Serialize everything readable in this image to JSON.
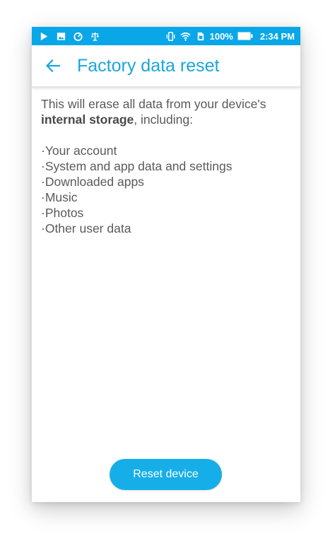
{
  "status_bar": {
    "left_icons": [
      "play-store-icon",
      "image-icon",
      "speedometer-icon",
      "scale-icon"
    ],
    "right_icons": [
      "vibrate-icon",
      "wifi-icon",
      "sim-icon"
    ],
    "battery_percent": "100%",
    "time": "2:34 PM"
  },
  "header": {
    "title": "Factory data reset",
    "back_icon": "arrow-left-icon"
  },
  "content": {
    "intro_prefix": "This will erase all data from your device's",
    "intro_bold": "internal storage",
    "intro_suffix": ", including:",
    "items": [
      "Your account",
      "System and app data and settings",
      "Downloaded apps",
      "Music",
      "Photos",
      "Other user data"
    ]
  },
  "actions": {
    "reset_label": "Reset device"
  },
  "colors": {
    "status_bar": "#0aa7e8",
    "accent": "#1aa6dc",
    "button": "#16aee8",
    "body_text": "#5a5a5a"
  }
}
